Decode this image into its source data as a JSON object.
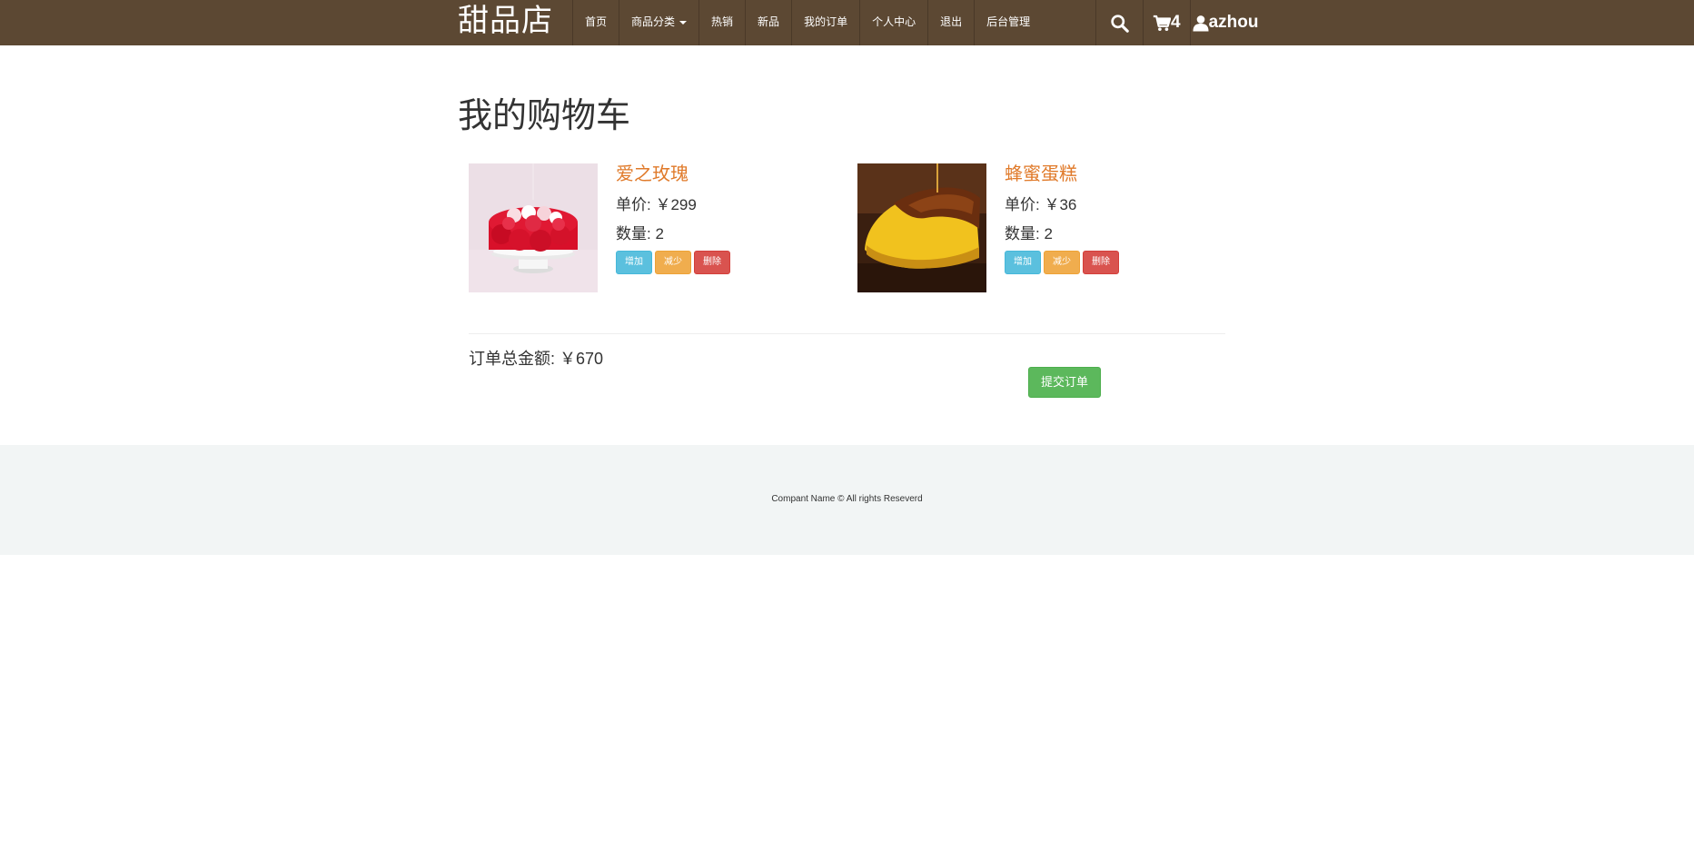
{
  "navbar": {
    "brand": "甜品店",
    "items": [
      {
        "label": "首页"
      },
      {
        "label": "商品分类",
        "dropdown": true
      },
      {
        "label": "热销"
      },
      {
        "label": "新品"
      },
      {
        "label": "我的订单"
      },
      {
        "label": "个人中心"
      },
      {
        "label": "退出"
      },
      {
        "label": "后台管理"
      }
    ],
    "search_icon": "search-icon",
    "cart_icon": "shopping-cart-icon",
    "cart_count": "4",
    "user_icon": "user-icon",
    "username": "azhou",
    "colors": {
      "background": "#5c4833"
    }
  },
  "main": {
    "title": "我的购物车",
    "items": [
      {
        "name": "爱之玫瑰",
        "price_text": "单价: ￥299",
        "qty_text": "数量: 2",
        "image": "rose-cake-image",
        "buttons": {
          "add": "增加",
          "reduce": "减少",
          "delete": "删除"
        }
      },
      {
        "name": "蜂蜜蛋糕",
        "price_text": "单价: ￥36",
        "qty_text": "数量: 2",
        "image": "honey-cake-image",
        "buttons": {
          "add": "增加",
          "reduce": "减少",
          "delete": "删除"
        }
      }
    ],
    "total_text": "订单总金额: ￥670",
    "submit_label": "提交订单",
    "colors": {
      "product_name": "#e07a2a",
      "btn_add": "#5bc0de",
      "btn_reduce": "#f0ad4e",
      "btn_delete": "#d9534f",
      "btn_submit": "#5cb85c"
    }
  },
  "footer": {
    "text": "Compant Name © All rights Reseverd"
  }
}
